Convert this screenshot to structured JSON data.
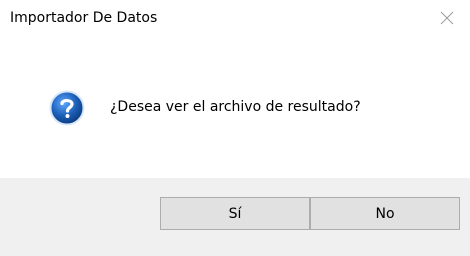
{
  "window": {
    "title": "Importador De Datos",
    "close_icon": "close-icon"
  },
  "message": {
    "icon": "question-icon",
    "text": "¿Desea ver el archivo de resultado?"
  },
  "buttons": {
    "yes_label": "Sí",
    "no_label": "No"
  },
  "colors": {
    "footer_bg": "#f0f0f0",
    "button_bg": "#e1e1e1",
    "button_border": "#adadad",
    "icon_blue": "#1b5fb7"
  }
}
